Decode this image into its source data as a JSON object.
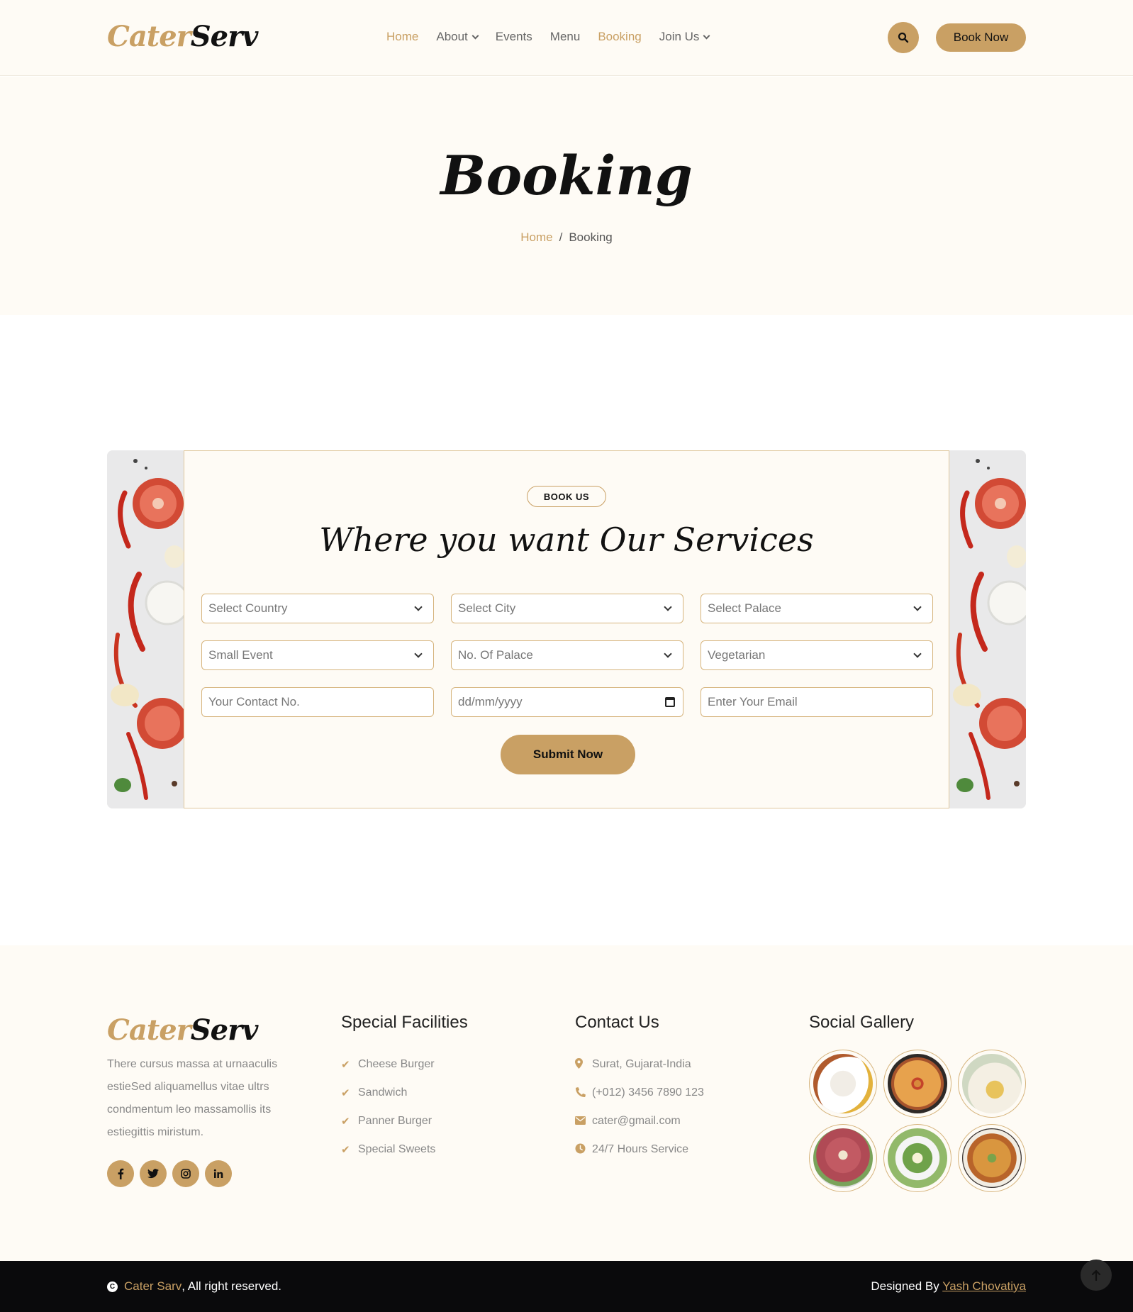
{
  "header": {
    "logo_part1": "Cater",
    "logo_part2": "Serv",
    "nav": [
      {
        "label": "Home",
        "active": true
      },
      {
        "label": "About",
        "dropdown": true
      },
      {
        "label": "Events"
      },
      {
        "label": "Menu"
      },
      {
        "label": "Booking",
        "active": true
      },
      {
        "label": "Join Us",
        "dropdown": true
      }
    ],
    "search_icon": "search-icon",
    "book_label": "Book Now"
  },
  "hero": {
    "title": "Booking",
    "breadcrumb_home": "Home",
    "breadcrumb_sep": "/",
    "breadcrumb_current": "Booking"
  },
  "booking": {
    "badge": "BOOK US",
    "title": "Where you want Our Services",
    "fields": {
      "country": "Select Country",
      "city": "Select City",
      "palace": "Select Palace",
      "event": "Small Event",
      "palace_count": "No. Of Palace",
      "diet": "Vegetarian",
      "contact_placeholder": "Your Contact No.",
      "date_placeholder": "dd/mm/yyyy",
      "email_placeholder": "Enter Your Email"
    },
    "submit_label": "Submit Now"
  },
  "footer": {
    "logo_part1": "Cater",
    "logo_part2": "Serv",
    "about": "There cursus massa at urnaaculis estieSed aliquamellus vitae ultrs condmentum leo massamollis its estiegittis miristum.",
    "socials": [
      "f",
      "t",
      "ig",
      "in"
    ],
    "facilities_title": "Special Facilities",
    "facilities": [
      "Cheese Burger",
      "Sandwich",
      "Panner Burger",
      "Special Sweets"
    ],
    "contact_title": "Contact Us",
    "contact": [
      {
        "icon": "map-marker-icon",
        "text": "Surat, Gujarat-India"
      },
      {
        "icon": "phone-icon",
        "text": "(+012) 3456 7890 123"
      },
      {
        "icon": "envelope-icon",
        "text": "cater@gmail.com"
      },
      {
        "icon": "clock-icon",
        "text": "24/7 Hours Service"
      }
    ],
    "gallery_title": "Social Gallery",
    "gallery": [
      "food-plate",
      "pizza",
      "tea",
      "salami",
      "salad",
      "pizza-2"
    ]
  },
  "bottom": {
    "brand": "Cater Sarv",
    "rights": ", All right reserved.",
    "designed_by": "Designed By",
    "author": "Yash Chovatiya"
  },
  "colors": {
    "accent": "#c9a064",
    "cream": "#fefbf5",
    "dark": "#0a0a0c"
  }
}
